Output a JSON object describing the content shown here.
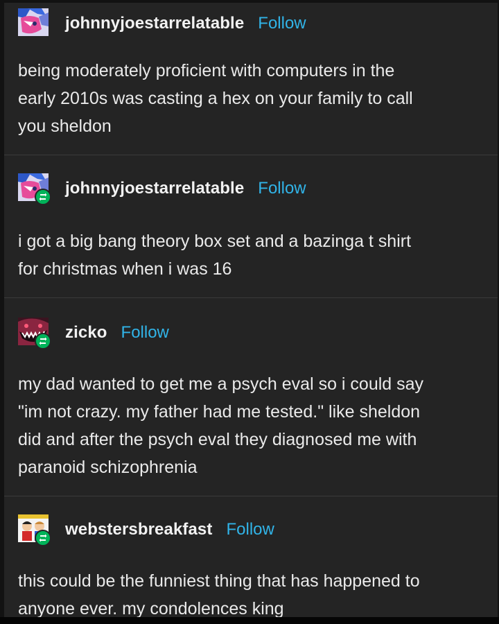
{
  "posts": [
    {
      "username": "johnnyjoestarrelatable",
      "follow_label": "Follow",
      "avatar_icon": "anime-character-avatar",
      "reblogged": false,
      "lines": [
        "being moderately proficient with computers in the",
        "early 2010s was casting a hex on your family to call",
        "you sheldon"
      ]
    },
    {
      "username": "johnnyjoestarrelatable",
      "follow_label": "Follow",
      "avatar_icon": "anime-character-avatar",
      "reblogged": true,
      "lines": [
        "i got a big bang theory box set and a bazinga t shirt",
        "for christmas when i was 16"
      ]
    },
    {
      "username": "zicko",
      "follow_label": "Follow",
      "avatar_icon": "grinning-creature-avatar",
      "reblogged": true,
      "lines": [
        "my dad wanted to get me a psych eval so i could say",
        "\"im not crazy. my father had me tested.\" like sheldon",
        "did and after the psych eval they diagnosed me with",
        "paranoid schizophrenia"
      ]
    },
    {
      "username": "webstersbreakfast",
      "follow_label": "Follow",
      "avatar_icon": "cartoon-kids-avatar",
      "reblogged": true,
      "lines": [
        "this could be the funniest thing that has happened to",
        "anyone ever. my condolences king"
      ]
    }
  ],
  "colors": {
    "background": "#242424",
    "follow_link": "#31b4e8",
    "reblog_badge": "#00b35a",
    "divider": "#3b3b3b"
  }
}
